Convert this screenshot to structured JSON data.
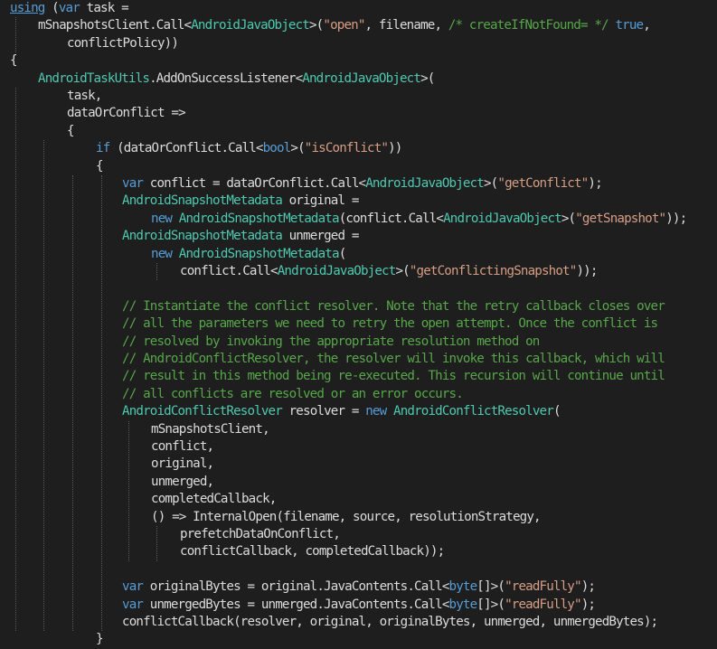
{
  "editor": {
    "language": "C#",
    "theme_colors": {
      "background": "#1e1e1e",
      "text": "#dcdcdc",
      "keyword": "#569cd6",
      "type": "#4ec9b0",
      "string": "#d69d85",
      "comment": "#57a64a",
      "indent_guide": "#5a5a5a"
    },
    "lines": [
      {
        "indent": 0,
        "tokens": [
          [
            "kw",
            "using"
          ],
          [
            "tx",
            " ("
          ],
          [
            "kw",
            "var"
          ],
          [
            "tx",
            " task ="
          ]
        ]
      },
      {
        "indent": 1,
        "tokens": [
          [
            "tx",
            "mSnapshotsClient.Call<"
          ],
          [
            "ty",
            "AndroidJavaObject"
          ],
          [
            "tx",
            ">("
          ],
          [
            "str",
            "\"open\""
          ],
          [
            "tx",
            ", filename, "
          ],
          [
            "cm",
            "/* createIfNotFound= */"
          ],
          [
            "tx",
            " "
          ],
          [
            "kw",
            "true"
          ],
          [
            "tx",
            ","
          ]
        ]
      },
      {
        "indent": 2,
        "tokens": [
          [
            "tx",
            "conflictPolicy))"
          ]
        ]
      },
      {
        "indent": 0,
        "tokens": [
          [
            "tx",
            "{"
          ]
        ]
      },
      {
        "indent": 1,
        "tokens": [
          [
            "ty",
            "AndroidTaskUtils"
          ],
          [
            "tx",
            ".AddOnSuccessListener<"
          ],
          [
            "ty",
            "AndroidJavaObject"
          ],
          [
            "tx",
            ">("
          ]
        ]
      },
      {
        "indent": 2,
        "tokens": [
          [
            "tx",
            "task,"
          ]
        ]
      },
      {
        "indent": 2,
        "tokens": [
          [
            "tx",
            "dataOrConflict =>"
          ]
        ]
      },
      {
        "indent": 2,
        "tokens": [
          [
            "tx",
            "{"
          ]
        ]
      },
      {
        "indent": 3,
        "tokens": [
          [
            "kw",
            "if"
          ],
          [
            "tx",
            " (dataOrConflict.Call<"
          ],
          [
            "kw",
            "bool"
          ],
          [
            "tx",
            ">("
          ],
          [
            "str",
            "\"isConflict\""
          ],
          [
            "tx",
            "))"
          ]
        ]
      },
      {
        "indent": 3,
        "tokens": [
          [
            "tx",
            "{"
          ]
        ]
      },
      {
        "indent": 4,
        "tokens": [
          [
            "kw",
            "var"
          ],
          [
            "tx",
            " conflict = dataOrConflict.Call<"
          ],
          [
            "ty",
            "AndroidJavaObject"
          ],
          [
            "tx",
            ">("
          ],
          [
            "str",
            "\"getConflict\""
          ],
          [
            "tx",
            ");"
          ]
        ]
      },
      {
        "indent": 4,
        "tokens": [
          [
            "ty",
            "AndroidSnapshotMetadata"
          ],
          [
            "tx",
            " original ="
          ]
        ]
      },
      {
        "indent": 5,
        "tokens": [
          [
            "kw",
            "new"
          ],
          [
            "tx",
            " "
          ],
          [
            "ty",
            "AndroidSnapshotMetadata"
          ],
          [
            "tx",
            "(conflict.Call<"
          ],
          [
            "ty",
            "AndroidJavaObject"
          ],
          [
            "tx",
            ">("
          ],
          [
            "str",
            "\"getSnapshot\""
          ],
          [
            "tx",
            "));"
          ]
        ]
      },
      {
        "indent": 4,
        "tokens": [
          [
            "ty",
            "AndroidSnapshotMetadata"
          ],
          [
            "tx",
            " unmerged ="
          ]
        ]
      },
      {
        "indent": 5,
        "tokens": [
          [
            "kw",
            "new"
          ],
          [
            "tx",
            " "
          ],
          [
            "ty",
            "AndroidSnapshotMetadata"
          ],
          [
            "tx",
            "("
          ]
        ]
      },
      {
        "indent": 6,
        "tokens": [
          [
            "tx",
            "conflict.Call<"
          ],
          [
            "ty",
            "AndroidJavaObject"
          ],
          [
            "tx",
            ">("
          ],
          [
            "str",
            "\"getConflictingSnapshot\""
          ],
          [
            "tx",
            "));"
          ]
        ]
      },
      {
        "indent": 4,
        "tokens": []
      },
      {
        "indent": 4,
        "tokens": [
          [
            "cm",
            "// Instantiate the conflict resolver. Note that the retry callback closes over"
          ]
        ]
      },
      {
        "indent": 4,
        "tokens": [
          [
            "cm",
            "// all the parameters we need to retry the open attempt. Once the conflict is"
          ]
        ]
      },
      {
        "indent": 4,
        "tokens": [
          [
            "cm",
            "// resolved by invoking the appropriate resolution method on"
          ]
        ]
      },
      {
        "indent": 4,
        "tokens": [
          [
            "cm",
            "// AndroidConflictResolver, the resolver will invoke this callback, which will"
          ]
        ]
      },
      {
        "indent": 4,
        "tokens": [
          [
            "cm",
            "// result in this method being re-executed. This recursion will continue until"
          ]
        ]
      },
      {
        "indent": 4,
        "tokens": [
          [
            "cm",
            "// all conflicts are resolved or an error occurs."
          ]
        ]
      },
      {
        "indent": 4,
        "tokens": [
          [
            "ty",
            "AndroidConflictResolver"
          ],
          [
            "tx",
            " resolver = "
          ],
          [
            "kw",
            "new"
          ],
          [
            "tx",
            " "
          ],
          [
            "ty",
            "AndroidConflictResolver"
          ],
          [
            "tx",
            "("
          ]
        ]
      },
      {
        "indent": 5,
        "tokens": [
          [
            "tx",
            "mSnapshotsClient,"
          ]
        ]
      },
      {
        "indent": 5,
        "tokens": [
          [
            "tx",
            "conflict,"
          ]
        ]
      },
      {
        "indent": 5,
        "tokens": [
          [
            "tx",
            "original,"
          ]
        ]
      },
      {
        "indent": 5,
        "tokens": [
          [
            "tx",
            "unmerged,"
          ]
        ]
      },
      {
        "indent": 5,
        "tokens": [
          [
            "tx",
            "completedCallback,"
          ]
        ]
      },
      {
        "indent": 5,
        "tokens": [
          [
            "tx",
            "() => InternalOpen(filename, source, resolutionStrategy,"
          ]
        ]
      },
      {
        "indent": 6,
        "tokens": [
          [
            "tx",
            "prefetchDataOnConflict,"
          ]
        ]
      },
      {
        "indent": 6,
        "tokens": [
          [
            "tx",
            "conflictCallback, completedCallback));"
          ]
        ]
      },
      {
        "indent": 4,
        "tokens": []
      },
      {
        "indent": 4,
        "tokens": [
          [
            "kw",
            "var"
          ],
          [
            "tx",
            " originalBytes = original.JavaContents.Call<"
          ],
          [
            "kw",
            "byte"
          ],
          [
            "tx",
            "[]>("
          ],
          [
            "str",
            "\"readFully\""
          ],
          [
            "tx",
            ");"
          ]
        ]
      },
      {
        "indent": 4,
        "tokens": [
          [
            "kw",
            "var"
          ],
          [
            "tx",
            " unmergedBytes = unmerged.JavaContents.Call<"
          ],
          [
            "kw",
            "byte"
          ],
          [
            "tx",
            "[]>("
          ],
          [
            "str",
            "\"readFully\""
          ],
          [
            "tx",
            ");"
          ]
        ]
      },
      {
        "indent": 4,
        "tokens": [
          [
            "tx",
            "conflictCallback(resolver, original, originalBytes, unmerged, unmergedBytes);"
          ]
        ]
      },
      {
        "indent": 3,
        "tokens": [
          [
            "tx",
            "}"
          ]
        ]
      }
    ]
  }
}
